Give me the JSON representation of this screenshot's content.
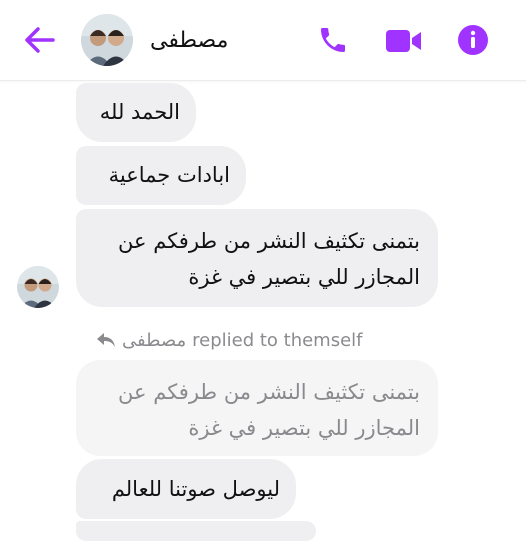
{
  "header": {
    "contact_name": "مصطفى",
    "back_icon": "arrow-left-icon",
    "call_icon": "phone-icon",
    "video_icon": "video-camera-icon",
    "info_icon": "info-icon",
    "accent_color": "#a033ff"
  },
  "messages": [
    {
      "text": "الحمد لله"
    },
    {
      "text": "ابادات جماعية"
    },
    {
      "lines": [
        "بتمنى تكثيف النشر من طرفكم عن",
        "المجازر للي بتصير في غزة"
      ]
    }
  ],
  "reply": {
    "sender": "مصطفى",
    "label": "replied to themself",
    "quoted_lines": [
      "بتمنى تكثيف النشر من طرفكم عن",
      "المجازر للي بتصير في غزة"
    ],
    "text": "ليوصل صوتنا للعالم"
  },
  "colors": {
    "bubble_bg": "#efeff1",
    "quoted_bg": "#f5f5f6",
    "text": "#111111",
    "muted_text": "#8b8b8f"
  }
}
